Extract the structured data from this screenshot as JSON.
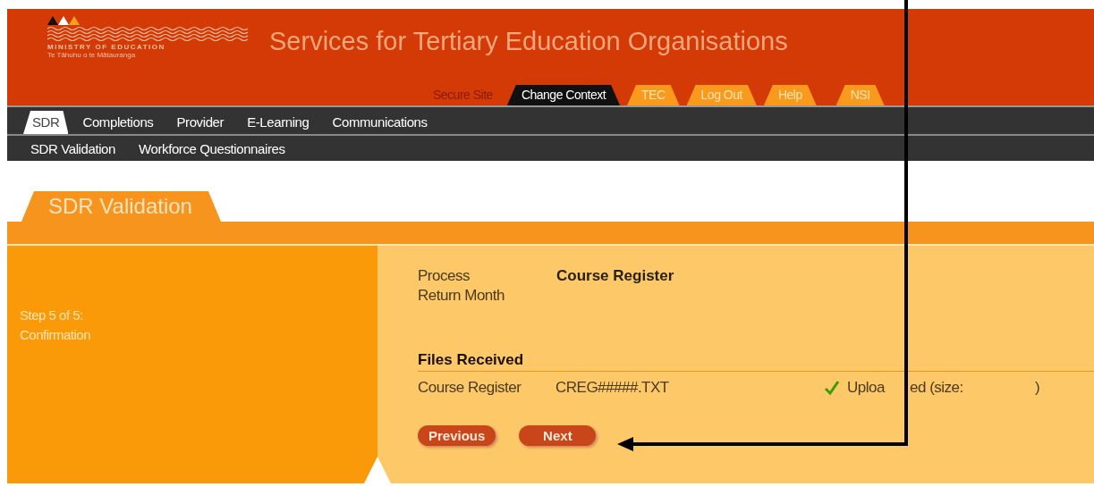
{
  "header": {
    "logo": {
      "name": "MINISTRY OF EDUCATION",
      "tagline": "Te Tāhuhu o te Mātauranga"
    },
    "title": "Services for Tertiary Education Organisations"
  },
  "site_tabs": [
    {
      "label": "Secure Site",
      "kind": "label"
    },
    {
      "label": "Change Context",
      "kind": "tab",
      "selected": true
    },
    {
      "label": "TEC",
      "kind": "tab",
      "selected": false
    },
    {
      "label": "Log Out",
      "kind": "tab",
      "selected": false
    },
    {
      "label": "Help",
      "kind": "tab",
      "selected": false
    },
    {
      "label": "NSI",
      "kind": "tab",
      "selected": false
    }
  ],
  "main_nav": [
    {
      "label": "SDR",
      "selected": true
    },
    {
      "label": "Completions",
      "selected": false
    },
    {
      "label": "Provider",
      "selected": false
    },
    {
      "label": "E-Learning",
      "selected": false
    },
    {
      "label": "Communications",
      "selected": false
    }
  ],
  "sub_nav": [
    "SDR Validation",
    "Workforce Questionnaires"
  ],
  "page_tab": "SDR Validation",
  "step": {
    "line1": "Step 5 of 5:",
    "line2": "Confirmation"
  },
  "details": [
    {
      "label": "Process",
      "value": "Course Register"
    },
    {
      "label": "Return Month"
    }
  ],
  "files": {
    "heading": "Files Received",
    "rows": [
      {
        "name": "Course Register",
        "file": "CREG#####.TXT",
        "status_start": "Uploa",
        "status": "ed (size:",
        "status_end": ")",
        "uploaded": true
      }
    ]
  },
  "buttons": [
    "Previous",
    "Next"
  ]
}
